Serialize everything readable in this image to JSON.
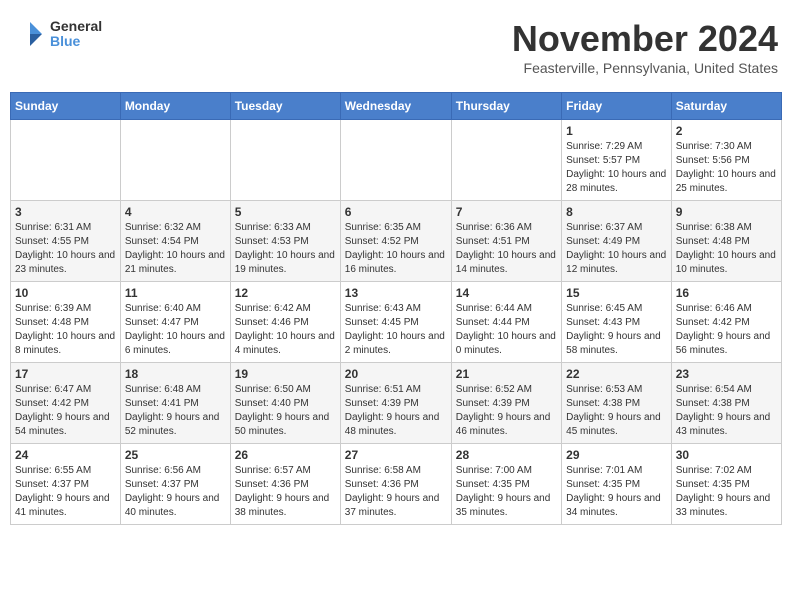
{
  "logo": {
    "general": "General",
    "blue": "Blue"
  },
  "title": "November 2024",
  "location": "Feasterville, Pennsylvania, United States",
  "days_of_week": [
    "Sunday",
    "Monday",
    "Tuesday",
    "Wednesday",
    "Thursday",
    "Friday",
    "Saturday"
  ],
  "weeks": [
    [
      {
        "day": "",
        "info": ""
      },
      {
        "day": "",
        "info": ""
      },
      {
        "day": "",
        "info": ""
      },
      {
        "day": "",
        "info": ""
      },
      {
        "day": "",
        "info": ""
      },
      {
        "day": "1",
        "info": "Sunrise: 7:29 AM\nSunset: 5:57 PM\nDaylight: 10 hours and 28 minutes."
      },
      {
        "day": "2",
        "info": "Sunrise: 7:30 AM\nSunset: 5:56 PM\nDaylight: 10 hours and 25 minutes."
      }
    ],
    [
      {
        "day": "3",
        "info": "Sunrise: 6:31 AM\nSunset: 4:55 PM\nDaylight: 10 hours and 23 minutes."
      },
      {
        "day": "4",
        "info": "Sunrise: 6:32 AM\nSunset: 4:54 PM\nDaylight: 10 hours and 21 minutes."
      },
      {
        "day": "5",
        "info": "Sunrise: 6:33 AM\nSunset: 4:53 PM\nDaylight: 10 hours and 19 minutes."
      },
      {
        "day": "6",
        "info": "Sunrise: 6:35 AM\nSunset: 4:52 PM\nDaylight: 10 hours and 16 minutes."
      },
      {
        "day": "7",
        "info": "Sunrise: 6:36 AM\nSunset: 4:51 PM\nDaylight: 10 hours and 14 minutes."
      },
      {
        "day": "8",
        "info": "Sunrise: 6:37 AM\nSunset: 4:49 PM\nDaylight: 10 hours and 12 minutes."
      },
      {
        "day": "9",
        "info": "Sunrise: 6:38 AM\nSunset: 4:48 PM\nDaylight: 10 hours and 10 minutes."
      }
    ],
    [
      {
        "day": "10",
        "info": "Sunrise: 6:39 AM\nSunset: 4:48 PM\nDaylight: 10 hours and 8 minutes."
      },
      {
        "day": "11",
        "info": "Sunrise: 6:40 AM\nSunset: 4:47 PM\nDaylight: 10 hours and 6 minutes."
      },
      {
        "day": "12",
        "info": "Sunrise: 6:42 AM\nSunset: 4:46 PM\nDaylight: 10 hours and 4 minutes."
      },
      {
        "day": "13",
        "info": "Sunrise: 6:43 AM\nSunset: 4:45 PM\nDaylight: 10 hours and 2 minutes."
      },
      {
        "day": "14",
        "info": "Sunrise: 6:44 AM\nSunset: 4:44 PM\nDaylight: 10 hours and 0 minutes."
      },
      {
        "day": "15",
        "info": "Sunrise: 6:45 AM\nSunset: 4:43 PM\nDaylight: 9 hours and 58 minutes."
      },
      {
        "day": "16",
        "info": "Sunrise: 6:46 AM\nSunset: 4:42 PM\nDaylight: 9 hours and 56 minutes."
      }
    ],
    [
      {
        "day": "17",
        "info": "Sunrise: 6:47 AM\nSunset: 4:42 PM\nDaylight: 9 hours and 54 minutes."
      },
      {
        "day": "18",
        "info": "Sunrise: 6:48 AM\nSunset: 4:41 PM\nDaylight: 9 hours and 52 minutes."
      },
      {
        "day": "19",
        "info": "Sunrise: 6:50 AM\nSunset: 4:40 PM\nDaylight: 9 hours and 50 minutes."
      },
      {
        "day": "20",
        "info": "Sunrise: 6:51 AM\nSunset: 4:39 PM\nDaylight: 9 hours and 48 minutes."
      },
      {
        "day": "21",
        "info": "Sunrise: 6:52 AM\nSunset: 4:39 PM\nDaylight: 9 hours and 46 minutes."
      },
      {
        "day": "22",
        "info": "Sunrise: 6:53 AM\nSunset: 4:38 PM\nDaylight: 9 hours and 45 minutes."
      },
      {
        "day": "23",
        "info": "Sunrise: 6:54 AM\nSunset: 4:38 PM\nDaylight: 9 hours and 43 minutes."
      }
    ],
    [
      {
        "day": "24",
        "info": "Sunrise: 6:55 AM\nSunset: 4:37 PM\nDaylight: 9 hours and 41 minutes."
      },
      {
        "day": "25",
        "info": "Sunrise: 6:56 AM\nSunset: 4:37 PM\nDaylight: 9 hours and 40 minutes."
      },
      {
        "day": "26",
        "info": "Sunrise: 6:57 AM\nSunset: 4:36 PM\nDaylight: 9 hours and 38 minutes."
      },
      {
        "day": "27",
        "info": "Sunrise: 6:58 AM\nSunset: 4:36 PM\nDaylight: 9 hours and 37 minutes."
      },
      {
        "day": "28",
        "info": "Sunrise: 7:00 AM\nSunset: 4:35 PM\nDaylight: 9 hours and 35 minutes."
      },
      {
        "day": "29",
        "info": "Sunrise: 7:01 AM\nSunset: 4:35 PM\nDaylight: 9 hours and 34 minutes."
      },
      {
        "day": "30",
        "info": "Sunrise: 7:02 AM\nSunset: 4:35 PM\nDaylight: 9 hours and 33 minutes."
      }
    ]
  ]
}
